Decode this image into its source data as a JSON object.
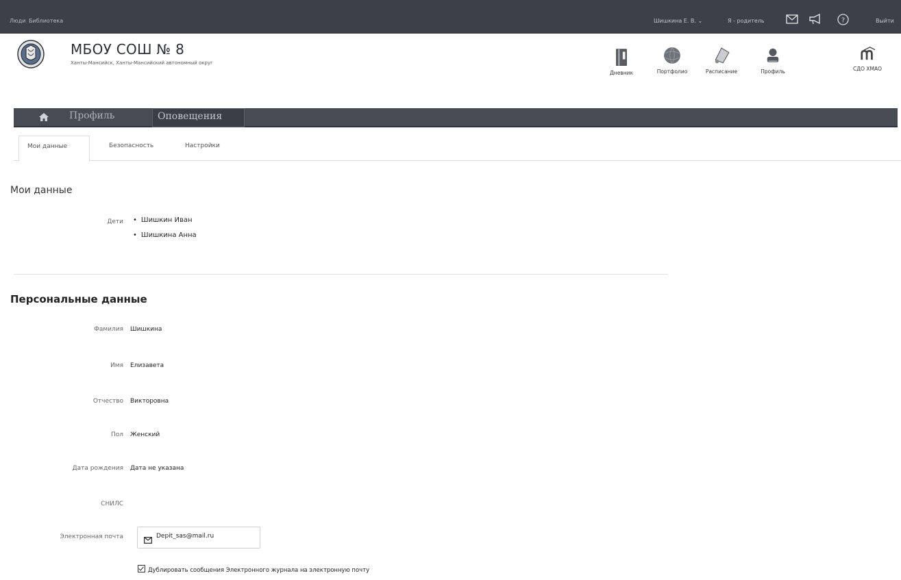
{
  "topbar": {
    "links": [
      "Люди",
      "Библиотека"
    ],
    "user_name": "Шишкина Е. В.",
    "user_role": "Я - родитель",
    "logout": "Выйти"
  },
  "header": {
    "school_name": "МБОУ СОШ № 8",
    "region": "Ханты-Мансийск, Ханты-Мансийский автономный округ",
    "quick_links": [
      "Дневник",
      "Портфолио",
      "Расписание",
      "Профиль",
      "СДО ХМАО"
    ]
  },
  "nav": {
    "items": [
      "Профиль",
      "Оповещения"
    ],
    "active": "Оповещения"
  },
  "tabs": {
    "items": [
      "Мои данные",
      "Безопасность",
      "Настройки"
    ],
    "active": "Мои данные"
  },
  "my_data": {
    "title": "Мои данные",
    "children_label": "Дети",
    "children": [
      "Шишкин Иван",
      "Шишкина Анна"
    ]
  },
  "personal": {
    "title": "Персональные данные",
    "fields": [
      {
        "label": "Фамилия",
        "value": "Шишкина"
      },
      {
        "label": "Имя",
        "value": "Елизавета"
      },
      {
        "label": "Отчество",
        "value": "Викторовна"
      },
      {
        "label": "Пол",
        "value": "Женский"
      },
      {
        "label": "Дата рождения",
        "value": "Дата не указана"
      },
      {
        "label": "СНИЛС",
        "value": ""
      },
      {
        "label": "Электронная почта",
        "value": ""
      }
    ],
    "email": "Depit_sas@mail.ru",
    "duplicate_checkbox": "Дублировать сообщения Электронного журнала на электронную почту"
  },
  "colors": {
    "topbar": "#3c4048",
    "navbar": "#464b54"
  }
}
